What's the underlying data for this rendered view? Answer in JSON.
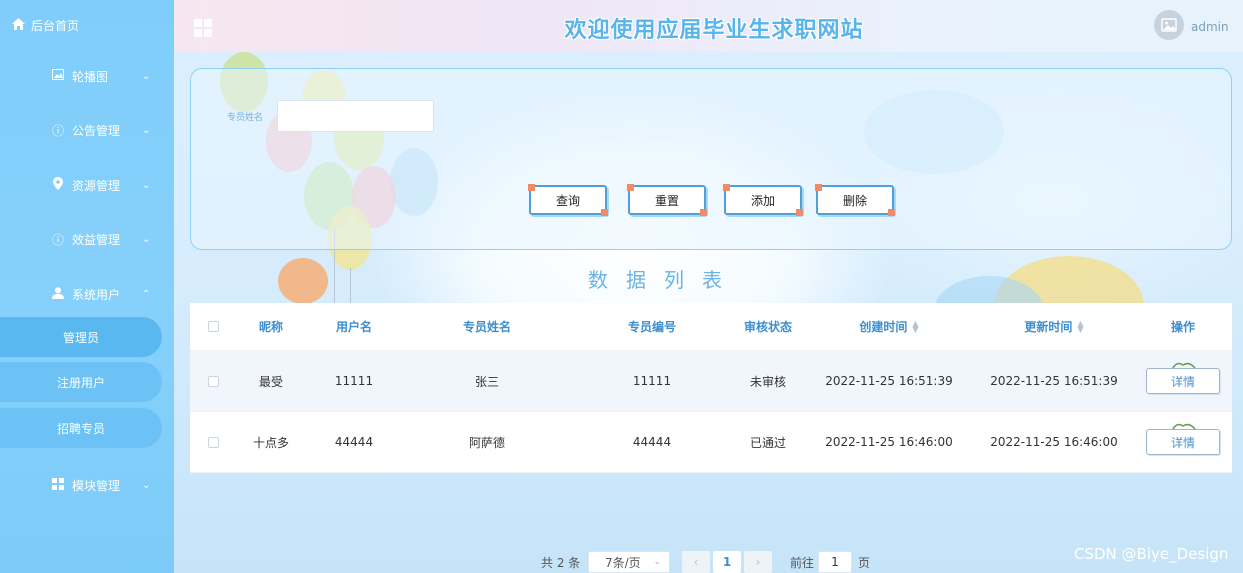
{
  "sidebar": {
    "home_label": "后台首页",
    "items": [
      {
        "label": "轮播图",
        "icon": "image-icon"
      },
      {
        "label": "公告管理",
        "icon": "info-icon"
      },
      {
        "label": "资源管理",
        "icon": "location-icon"
      },
      {
        "label": "效益管理",
        "icon": "info-icon"
      },
      {
        "label": "系统用户",
        "icon": "user-icon"
      }
    ],
    "sub_items": [
      "管理员",
      "注册用户",
      "招聘专员"
    ],
    "module_label": "模块管理"
  },
  "header": {
    "title": "欢迎使用应届毕业生求职网站",
    "username": "admin"
  },
  "search": {
    "label": "专员姓名",
    "value": "",
    "buttons": {
      "query": "查询",
      "reset": "重置",
      "add": "添加",
      "delete": "删除"
    }
  },
  "section_title": "数据列表",
  "table": {
    "columns": [
      "昵称",
      "用户名",
      "专员姓名",
      "专员编号",
      "审核状态",
      "创建时间",
      "更新时间",
      "操作"
    ],
    "rows": [
      {
        "nickname": "最受",
        "username": "11111",
        "name": "张三",
        "number": "11111",
        "status": "未审核",
        "created": "2022-11-25 16:51:39",
        "updated": "2022-11-25 16:51:39",
        "action": "详情"
      },
      {
        "nickname": "十点多",
        "username": "44444",
        "name": "阿萨德",
        "number": "44444",
        "status": "已通过",
        "created": "2022-11-25 16:46:00",
        "updated": "2022-11-25 16:46:00",
        "action": "详情"
      }
    ]
  },
  "pagination": {
    "total": "共 2 条",
    "page_size": "7条/页",
    "current_page": "1",
    "goto_label": "前往",
    "goto_value": "1",
    "page_suffix": "页"
  },
  "watermark": "CSDN @Biye_Design"
}
